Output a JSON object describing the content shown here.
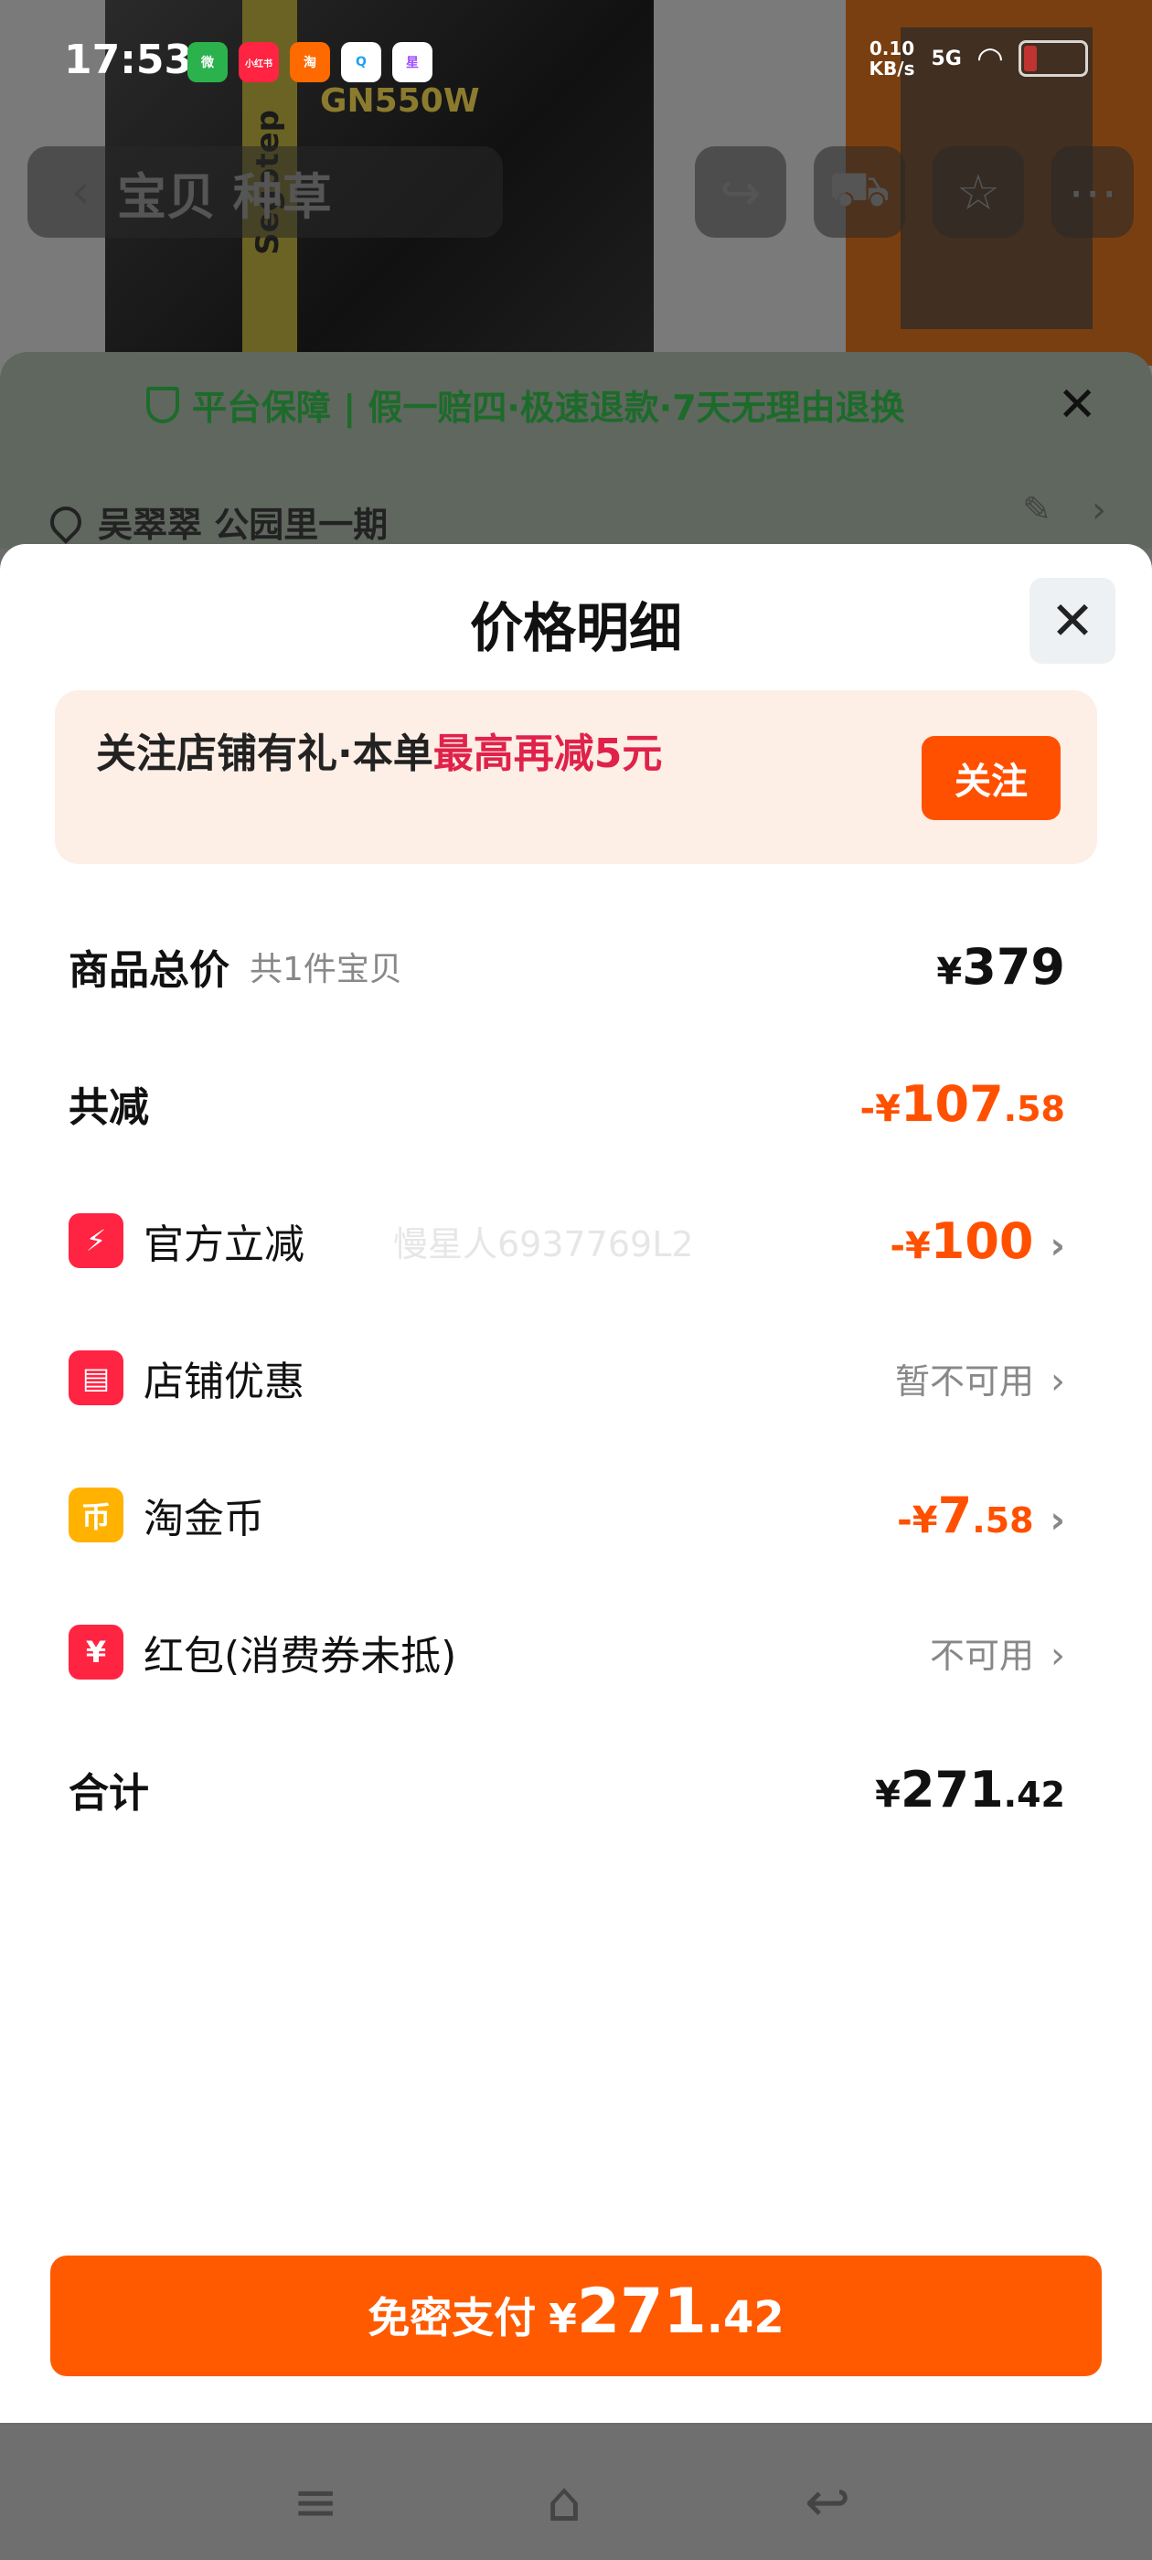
{
  "status": {
    "time": "17:53",
    "apps": [
      "微",
      "小红书",
      "淘",
      "Q",
      "星"
    ],
    "net_speed_top": "0.10",
    "net_speed_bottom": "KB/s",
    "signal": "5G"
  },
  "background": {
    "product_brand": "Segotep",
    "product_model": "GN550W",
    "nav_title": "宝贝 种草",
    "guarantee_text": "平台保障 | 假一赔四·极速退款·7天无理由退换",
    "address": "吴翠翠 公园里一期"
  },
  "sheet": {
    "title": "价格明细",
    "close_icon": "close-icon",
    "promo": {
      "text_prefix": "关注店铺有礼·本单",
      "text_highlight": "最高再减5元",
      "button": "关注"
    },
    "rows": {
      "total": {
        "label": "商品总价",
        "sub": "共1件宝贝",
        "currency": "¥",
        "value": "379"
      },
      "discount": {
        "label": "共减",
        "prefix": "-¥",
        "int": "107",
        "dec": ".58"
      },
      "official": {
        "label": "官方立减",
        "prefix": "-¥",
        "value": "100"
      },
      "shop": {
        "label": "店铺优惠",
        "status": "暂不可用"
      },
      "coin": {
        "label": "淘金币",
        "prefix": "-¥",
        "int": "7",
        "dec": ".58"
      },
      "redpacket": {
        "label": "红包(消费券未抵)",
        "status": "不可用"
      },
      "sum": {
        "label": "合计",
        "currency": "¥",
        "int": "271",
        "dec": ".42"
      }
    },
    "watermark": "慢星人6937769L2",
    "pay_button": {
      "label": "免密支付",
      "currency": "¥",
      "int": "271",
      "dec": ".42"
    }
  },
  "colors": {
    "accent": "#ff5000",
    "highlight": "#e0224a",
    "promo_bg": "#fdeee6"
  }
}
